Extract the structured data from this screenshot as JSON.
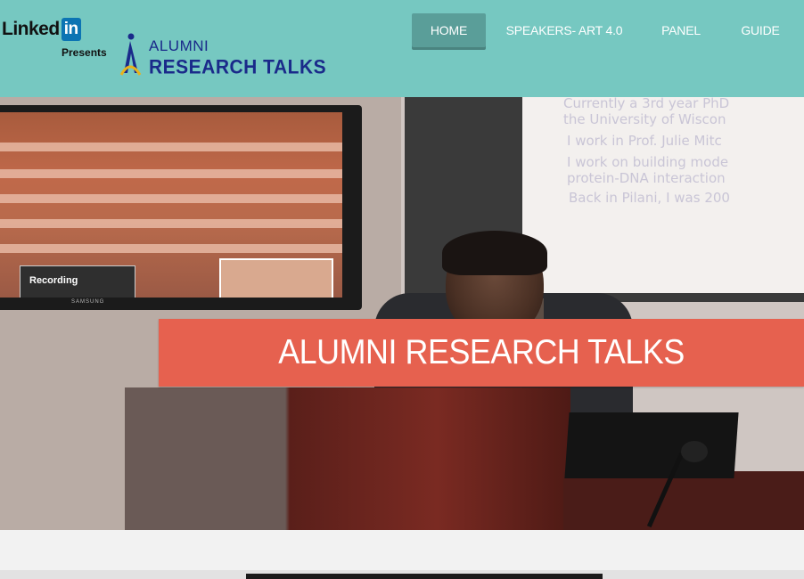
{
  "header": {
    "brand_word": "Linked",
    "brand_in": "in",
    "brand_presents": "Presents",
    "logo_alumni": "ALUMNI",
    "logo_title": "RESEARCH TALKS",
    "background_color": "#76c8c1",
    "logo_text_color": "#1a2a8a"
  },
  "nav": {
    "items": [
      {
        "label": "HOME",
        "active": true
      },
      {
        "label": "SPEAKERS- ART 4.0",
        "active": false
      },
      {
        "label": "PANEL",
        "active": false
      },
      {
        "label": "GUIDE",
        "active": false
      }
    ]
  },
  "hero": {
    "banner_text": "ALUMNI RESEARCH TALKS",
    "banner_color": "#e6614f",
    "photo": {
      "tv_recording_label": "Recording",
      "tv_brand": "SAMSUNG",
      "slide_lines": [
        "Currently a 3rd year PhD",
        "the University of Wiscon",
        "I work in Prof. Julie Mitc",
        "I work on building mode",
        "protein-DNA interaction",
        "Back in Pilani, I was 200"
      ]
    }
  }
}
